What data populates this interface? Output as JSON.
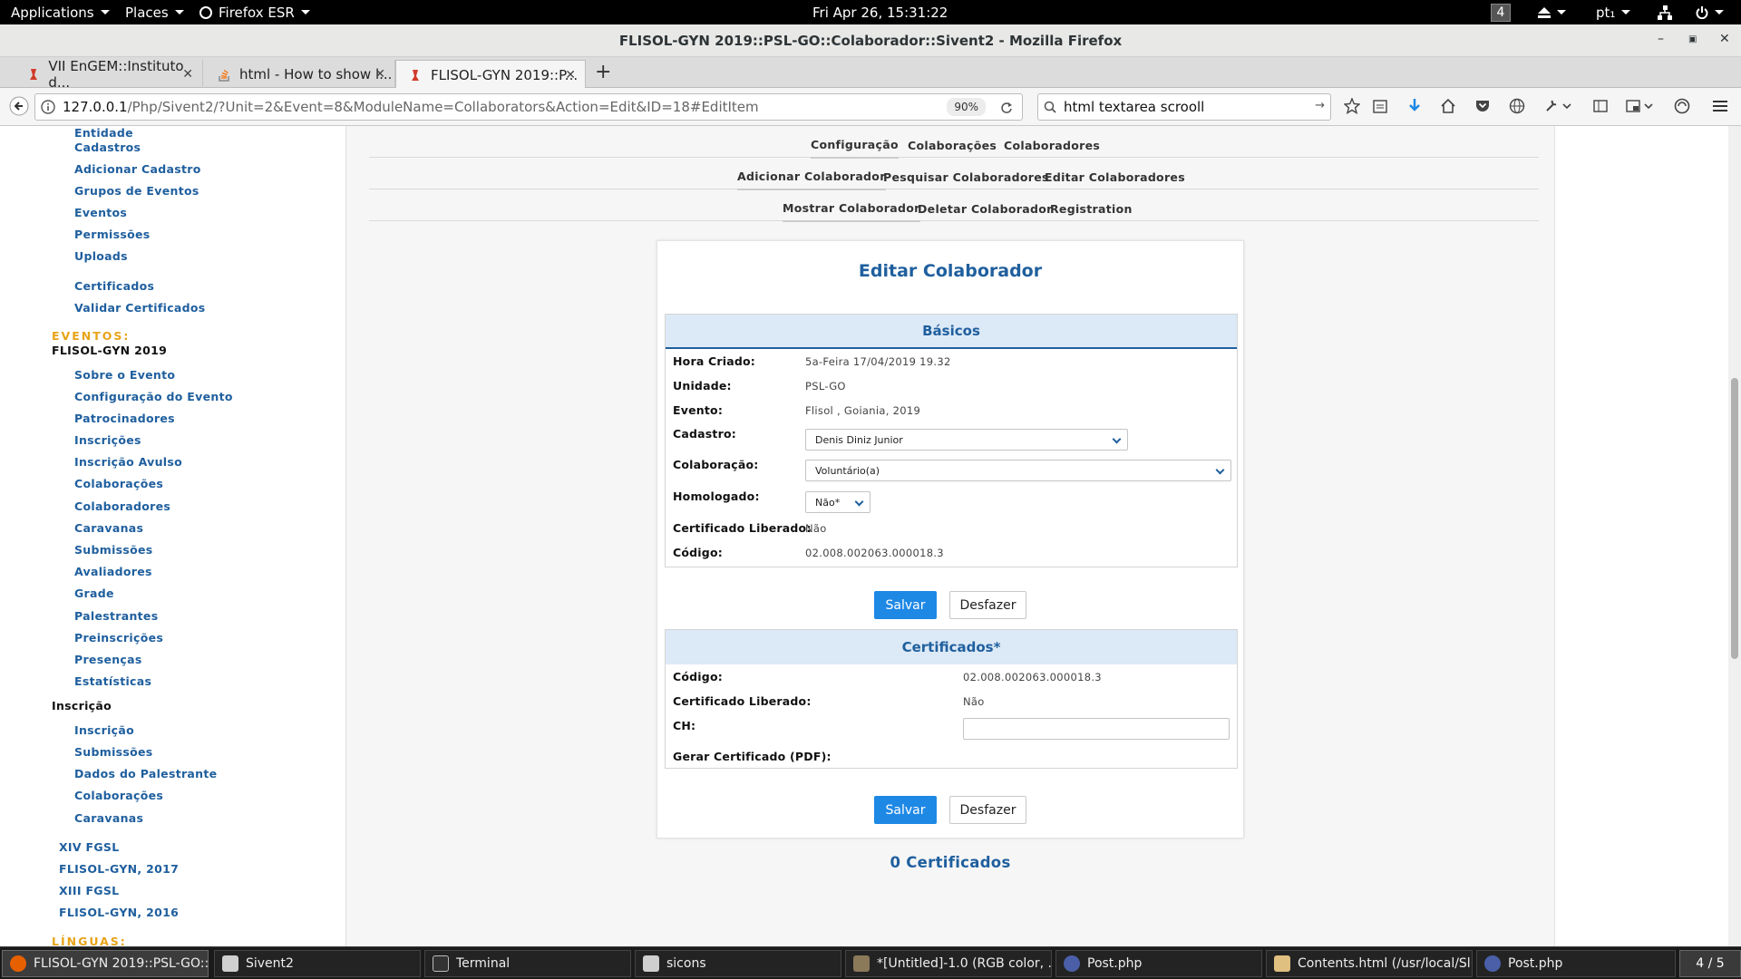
{
  "topbar": {
    "applications": "Applications",
    "places": "Places",
    "firefox": "Firefox ESR",
    "clock": "Fri Apr 26, 15:31:22",
    "workspace": "4",
    "lang": "pt₁"
  },
  "window": {
    "title": "FLISOL-GYN 2019::PSL-GO::Colaborador::Sivent2 - Mozilla Firefox"
  },
  "tabs": [
    {
      "label": "VII EnGEM::Instituto d..."
    },
    {
      "label": "html - How to show l..."
    },
    {
      "label": "FLISOL-GYN 2019::P..."
    }
  ],
  "nav": {
    "url_host": "127.0.0.1",
    "url_path": "/Php/Sivent2/?Unit=2&Event=8&ModuleName=Collaborators&Action=Edit&ID=18#EditItem",
    "zoom": "90%",
    "search_value": "html textarea scrooll"
  },
  "sidebar": {
    "top_items": [
      "Entidade",
      "Cadastros",
      "Adicionar Cadastro",
      "Grupos de Eventos",
      "Eventos",
      "Permissões",
      "Uploads"
    ],
    "cert_items": [
      "Certificados",
      "Validar Certificados"
    ],
    "eventos_header": "EVENTOS:",
    "event_name": "FLISOL-GYN 2019",
    "event_items": [
      "Sobre o Evento",
      "Configuração do Evento",
      "Patrocinadores",
      "Inscrições",
      "Inscrição Avulso",
      "Colaborações",
      "Colaboradores",
      "Caravanas",
      "Submissões",
      "Avaliadores",
      "Grade",
      "Palestrantes",
      "Preinscrições",
      "Presenças",
      "Estatísticas"
    ],
    "inscricao_header": "Inscrição",
    "inscricao_items": [
      "Inscrição",
      "Submissões",
      "Dados do Palestrante",
      "Colaborações",
      "Caravanas"
    ],
    "other_events": [
      "XIV FGSL",
      "FLISOL-GYN, 2017",
      "XIII FGSL",
      "FLISOL-GYN, 2016"
    ],
    "linguas_header": "LÍNGUAS:"
  },
  "menu": {
    "row1": [
      "Configuração",
      "Colaborações",
      "Colaboradores"
    ],
    "row2": [
      "Adicionar Colaborador",
      "Pesquisar Colaboradores",
      "Editar Colaboradores"
    ],
    "row3": [
      "Mostrar Colaborador",
      "Deletar Colaborador",
      "Registration"
    ]
  },
  "form": {
    "title": "Editar Colaborador",
    "basicos": {
      "header": "Básicos",
      "hora_label": "Hora Criado:",
      "hora_value": "5a-Feira 17/04/2019 19.32",
      "unidade_label": "Unidade:",
      "unidade_value": "PSL-GO",
      "evento_label": "Evento:",
      "evento_value": "Flisol , Goiania, 2019",
      "cadastro_label": "Cadastro:",
      "cadastro_value": "Denis Diniz Junior",
      "colaboracao_label": "Colaboração:",
      "colaboracao_value": "Voluntário(a)",
      "homologado_label": "Homologado:",
      "homologado_value": "Não*",
      "cert_liberado_label": "Certificado Liberado:",
      "cert_liberado_value": "Não",
      "codigo_label": "Código:",
      "codigo_value": "02.008.002063.000018.3"
    },
    "save_label": "Salvar",
    "undo_label": "Desfazer",
    "certificados": {
      "header": "Certificados*",
      "codigo_label": "Código:",
      "codigo_value": "02.008.002063.000018.3",
      "liberado_label": "Certificado Liberado:",
      "liberado_value": "Não",
      "ch_label": "CH:",
      "ch_value": "",
      "gerar_label": "Gerar Certificado (PDF):"
    },
    "count_label": "0 Certificados"
  },
  "taskbar": {
    "tasks": [
      "FLISOL-GYN 2019::PSL-GO::...",
      "Sivent2",
      "Terminal",
      "sicons",
      "*[Untitled]-1.0 (RGB color, ...",
      "Post.php",
      "Contents.html (/usr/local/Sli...",
      "Post.php"
    ],
    "pager": "4 / 5"
  },
  "colors": {
    "accent": "#1f5f9e",
    "button": "#1e88e5",
    "section_header": "#e8a317"
  }
}
